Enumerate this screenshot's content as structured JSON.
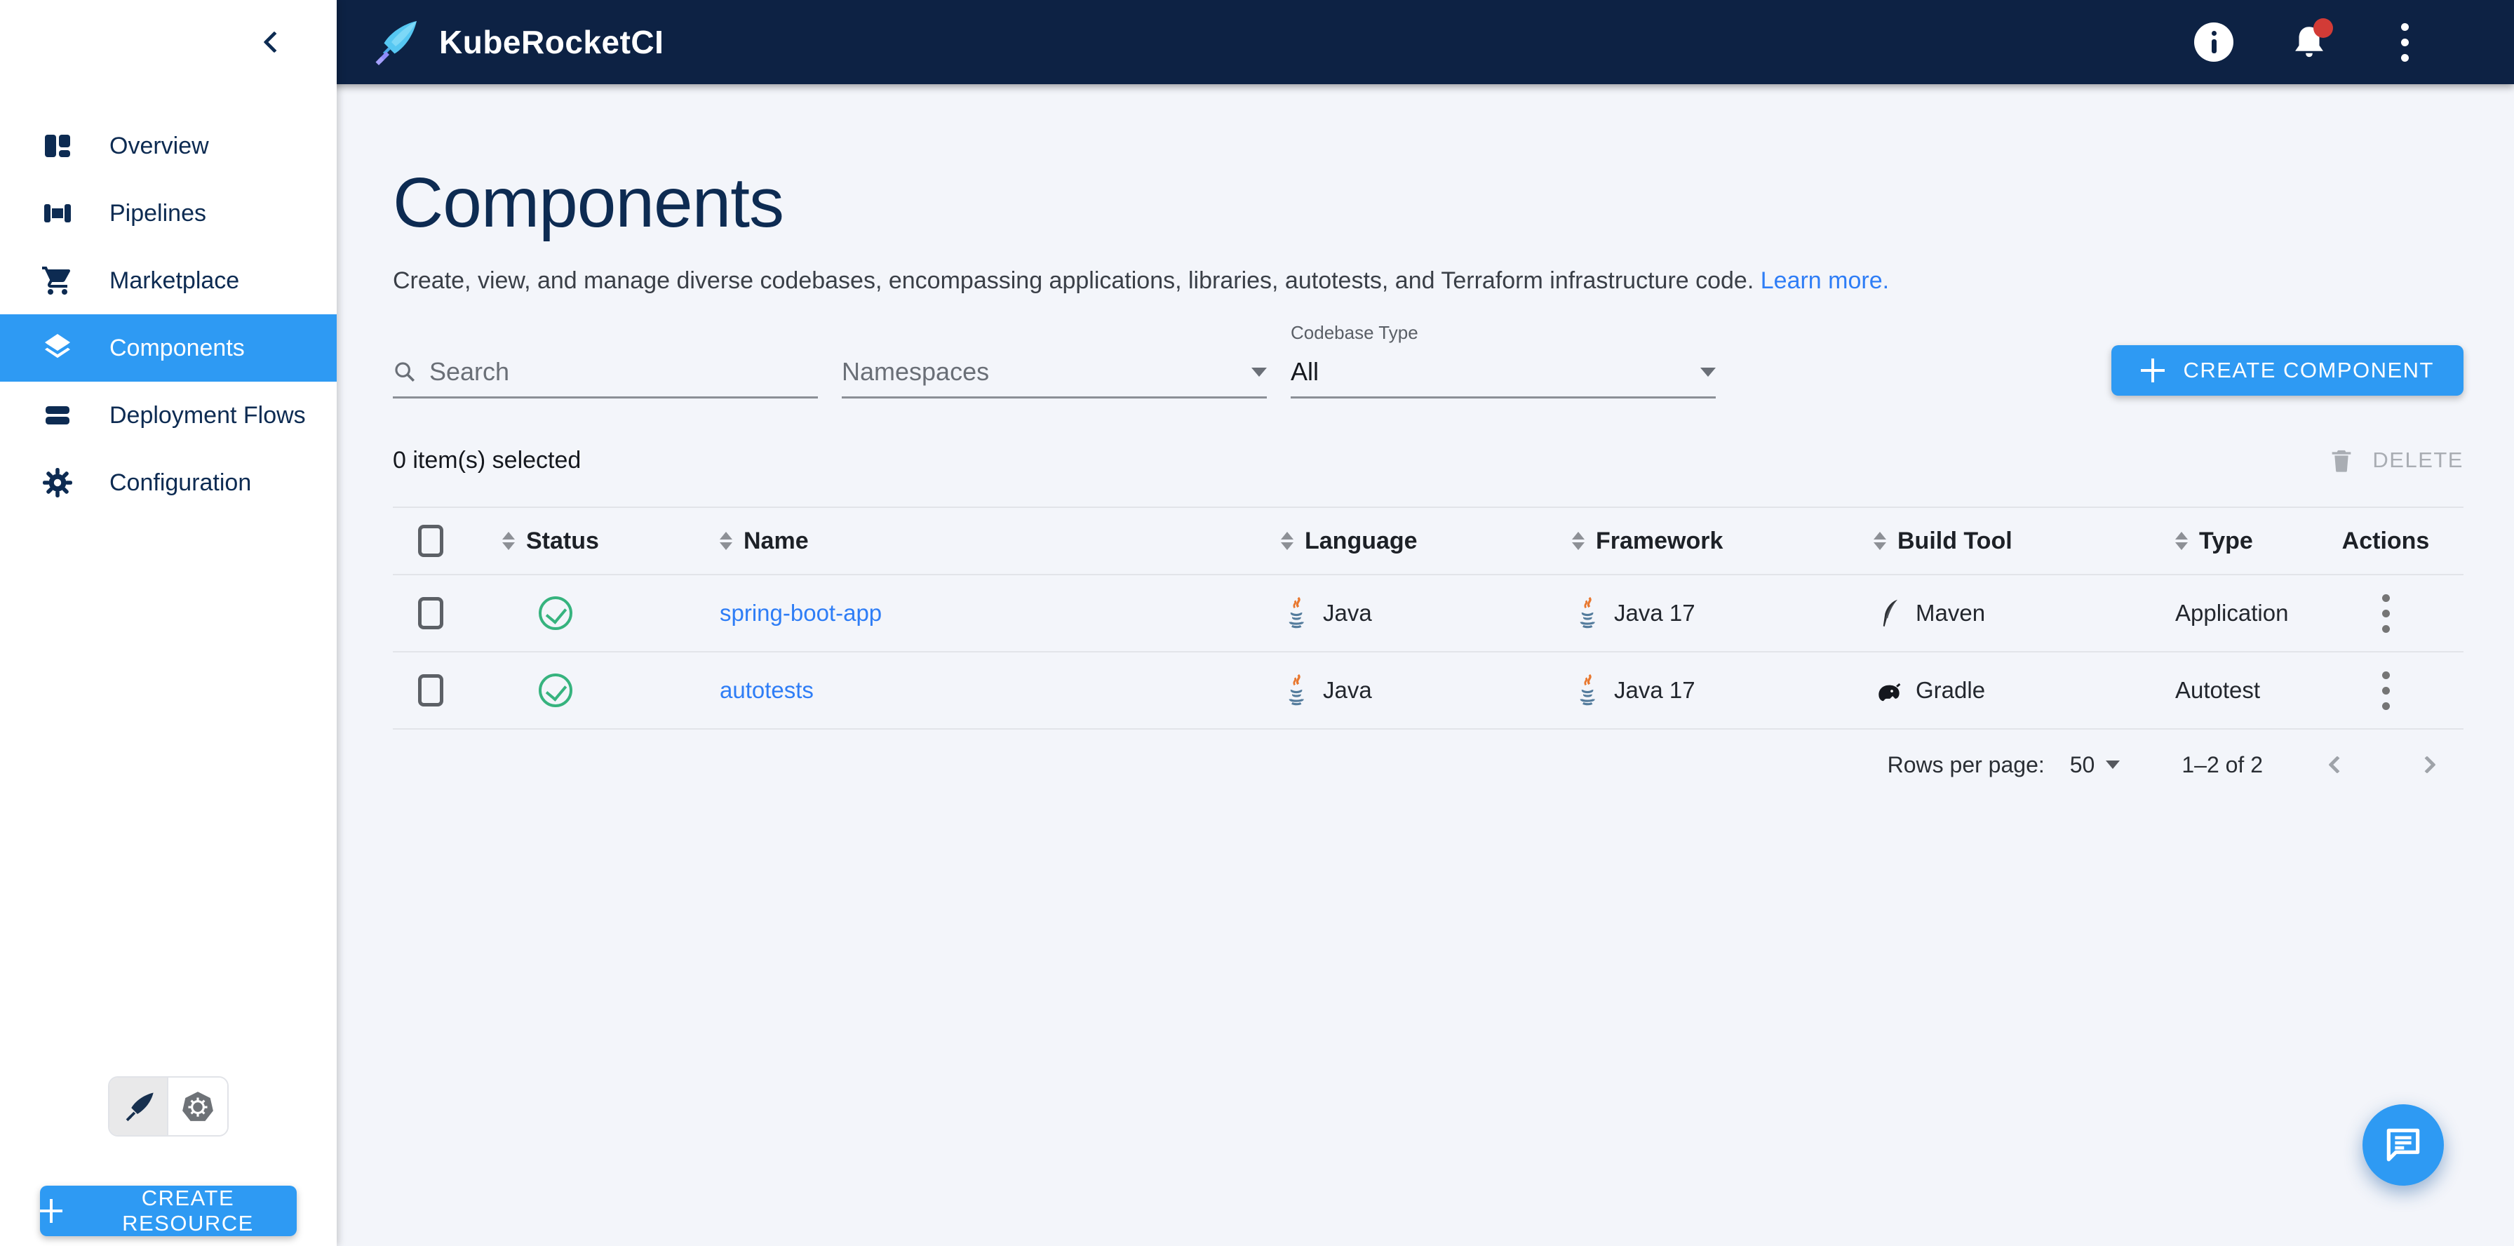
{
  "topbar": {
    "brand": "KubeRocketCI",
    "icons": [
      "info-icon",
      "notifications-icon",
      "kebab-icon"
    ]
  },
  "sidebar": {
    "items": [
      {
        "label": "Overview",
        "icon": "overview-icon",
        "selected": false
      },
      {
        "label": "Pipelines",
        "icon": "pipelines-icon",
        "selected": false
      },
      {
        "label": "Marketplace",
        "icon": "marketplace-cart-icon",
        "selected": false
      },
      {
        "label": "Components",
        "icon": "components-layers-icon",
        "selected": true
      },
      {
        "label": "Deployment Flows",
        "icon": "deployment-flows-icon",
        "selected": false
      },
      {
        "label": "Configuration",
        "icon": "configuration-gear-icon",
        "selected": false
      }
    ],
    "theme_toggle": {
      "options": [
        "rocket-theme",
        "kubernetes-theme"
      ],
      "selected": "rocket-theme"
    },
    "create_resource_label": "CREATE RESOURCE"
  },
  "page": {
    "title": "Components",
    "description": "Create, view, and manage diverse codebases, encompassing applications, libraries, autotests, and Terraform infrastructure code.",
    "learn_more": "Learn more."
  },
  "filters": {
    "search_placeholder": "Search",
    "namespaces_placeholder": "Namespaces",
    "codebase_type_label": "Codebase Type",
    "codebase_type_value": "All"
  },
  "actions": {
    "create_component": "CREATE COMPONENT",
    "delete": "DELETE"
  },
  "selection": {
    "text": "0 item(s) selected"
  },
  "table": {
    "columns": [
      "Status",
      "Name",
      "Language",
      "Framework",
      "Build Tool",
      "Type",
      "Actions"
    ],
    "rows": [
      {
        "status": "success",
        "name": "spring-boot-app",
        "language": "Java",
        "framework": "Java 17",
        "build_tool": "Maven",
        "type": "Application"
      },
      {
        "status": "success",
        "name": "autotests",
        "language": "Java",
        "framework": "Java 17",
        "build_tool": "Gradle",
        "type": "Autotest"
      }
    ]
  },
  "pagination": {
    "rows_per_page_label": "Rows per page:",
    "rows_per_page_value": "50",
    "range": "1–2 of 2"
  },
  "colors": {
    "topbar": "#0d2244",
    "accent": "#2e9af3",
    "link": "#2e7df6",
    "success": "#36b37e",
    "background": "#f3f5fa"
  }
}
